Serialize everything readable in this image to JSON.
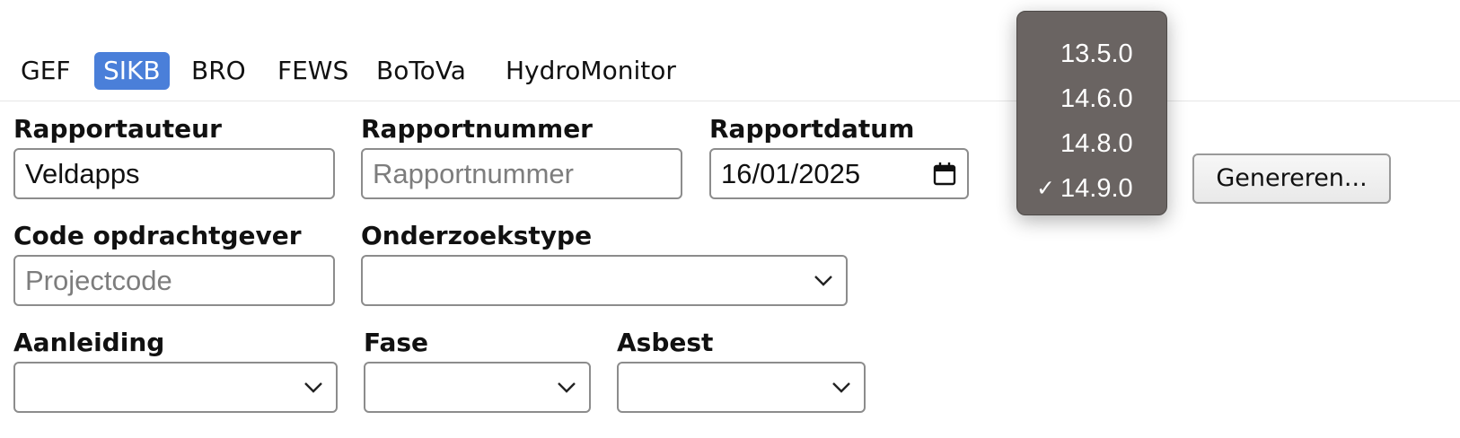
{
  "tabs": [
    {
      "label": "GEF",
      "active": false
    },
    {
      "label": "SIKB",
      "active": true
    },
    {
      "label": "BRO",
      "active": false
    },
    {
      "label": "FEWS",
      "active": false
    },
    {
      "label": "BoToVa",
      "active": false
    },
    {
      "label": "HydroMonitor",
      "active": false
    }
  ],
  "form": {
    "rapportauteur": {
      "label": "Rapportauteur",
      "value": "Veldapps"
    },
    "rapportnummer": {
      "label": "Rapportnummer",
      "placeholder": "Rapportnummer"
    },
    "rapportdatum": {
      "label": "Rapportdatum",
      "value": "16/01/2025"
    },
    "code_opdrachtgever": {
      "label": "Code opdrachtgever",
      "placeholder": "Projectcode"
    },
    "onderzoekstype": {
      "label": "Onderzoekstype",
      "value": ""
    },
    "aanleiding": {
      "label": "Aanleiding",
      "value": ""
    },
    "fase": {
      "label": "Fase",
      "value": ""
    },
    "asbest": {
      "label": "Asbest",
      "value": ""
    }
  },
  "generate_button": {
    "label": "Genereren..."
  },
  "version_dropdown": {
    "options": [
      "13.5.0",
      "14.6.0",
      "14.8.0",
      "14.9.0"
    ],
    "selected": "14.9.0",
    "check_mark": "✓"
  },
  "colors": {
    "active_tab_bg": "#4a7fd9",
    "popup_bg": "#6a6462",
    "input_border": "#8c8c8c"
  }
}
